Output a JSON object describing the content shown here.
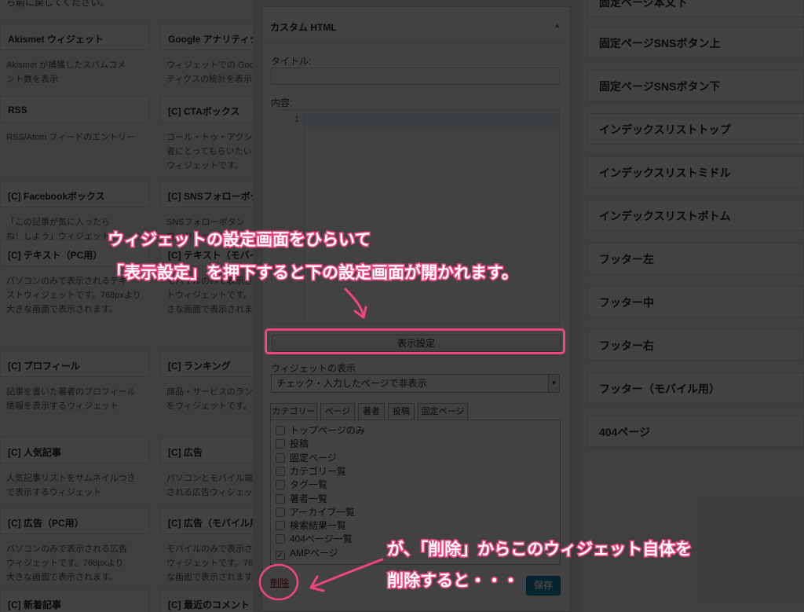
{
  "left": {
    "top_partial": "ら前に戻してください。",
    "widgets": [
      {
        "title": "Akismet ウィジェット",
        "desc": [
          "Akismet が捕獲したスパムコメ",
          "ント数を表示"
        ]
      },
      {
        "title": "Google アナリティクス",
        "desc": [
          "ウィジェットでの Google",
          "ティクスの統計を表示"
        ]
      },
      {
        "title": "RSS",
        "desc": [
          "RSS/Atom フィードのエントリー"
        ]
      },
      {
        "title": "[C] CTAボックス",
        "desc": [
          "コール・トゥ・アクション",
          "者にとってもらいたい",
          "ウィジェットです。"
        ]
      },
      {
        "title": "[C] Facebookボックス",
        "desc": [
          "「この記事が気に入ったら",
          "ね！しよう」ウィジェット"
        ]
      },
      {
        "title": "[C] SNSフォローボタン",
        "desc": [
          "SNSフォローボタン",
          "ウィジェットです。"
        ]
      },
      {
        "title": "[C] テキスト（PC用）",
        "desc": [
          "パソコンのみで表示されるテキ",
          "ストウィジェットです。768pxより",
          "大きな画面で表示されます。"
        ]
      },
      {
        "title": "[C] テキスト（モバイル用）",
        "desc": [
          "モバイルのみで表示さ",
          "トウィジェットです。",
          "さな画面で表示されます"
        ]
      },
      {
        "title": "[C] プロフィール",
        "desc": [
          "記事を書いた著者のプロフィール",
          "情報を表示するウィジェット"
        ]
      },
      {
        "title": "[C] ランキング",
        "desc": [
          "商品・サービスのランキ",
          "をウィジェットです。"
        ]
      },
      {
        "title": "[C] 人気記事",
        "desc": [
          "人気記事リストをサムネイルつき",
          "で表示するウィジェット"
        ]
      },
      {
        "title": "[C] 広告",
        "desc": [
          "パソコンとモバイル端末",
          "される広告ウィジェット"
        ]
      },
      {
        "title": "[C] 広告（PC用）",
        "desc": [
          "パソコンのみで表示される広告",
          "ウィジェットです。768pxより",
          "大きな画面で表示されます。"
        ]
      },
      {
        "title": "[C] 広告（モバイル用）",
        "desc": [
          "モバイルのみで表示さ",
          "ウィジェットです。76",
          "な画面で表示されます。"
        ]
      },
      {
        "title": "[C] 新着記事",
        "desc": []
      },
      {
        "title": "[C] 最近のコメント",
        "desc": []
      }
    ]
  },
  "panel": {
    "title": "カスタム HTML",
    "title_label": "タイトル:",
    "title_value": "",
    "content_label": "内容:",
    "line_number": "1",
    "display_settings_button": "表示設定",
    "visibility_label": "ウィジェットの表示",
    "visibility_select": "チェック・入力したページで非表示",
    "tabs": [
      "カテゴリー",
      "ページ",
      "著者",
      "投稿",
      "固定ページ"
    ],
    "options": [
      {
        "label": "トップページのみ",
        "checked": false
      },
      {
        "label": "投稿",
        "checked": false
      },
      {
        "label": "固定ページ",
        "checked": false
      },
      {
        "label": "カテゴリー覧",
        "checked": false
      },
      {
        "label": "タグ一覧",
        "checked": false
      },
      {
        "label": "著者一覧",
        "checked": false
      },
      {
        "label": "アーカイブ一覧",
        "checked": false
      },
      {
        "label": "検索結果一覧",
        "checked": false
      },
      {
        "label": "404ページ一覧",
        "checked": false
      },
      {
        "label": "AMPページ",
        "checked": true
      }
    ],
    "delete_link": "削除",
    "save_button": "保存"
  },
  "right": {
    "items": [
      "固定ページ本文下",
      "固定ページSNSボタン上",
      "固定ページSNSボタン下",
      "インデックスリストトップ",
      "インデックスリストミドル",
      "インデックスリストボトム",
      "フッター左",
      "フッター中",
      "フッター右",
      "フッター（モバイル用）",
      "404ページ"
    ]
  },
  "annotations": {
    "line1": "ウィジェットの設定画面をひらいて",
    "line2": "「表示設定」を押下すると下の設定画面が開かれます。",
    "line3": "が、「削除」からこのウィジェット自体を",
    "line4": "削除すると・・・",
    "accent_color": "#f0457f"
  }
}
